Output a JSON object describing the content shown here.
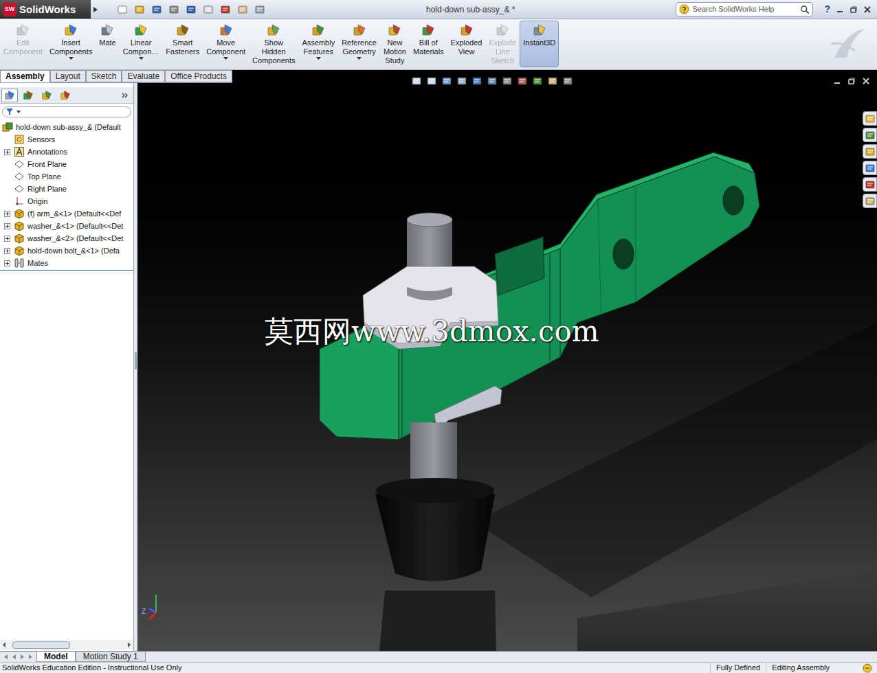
{
  "window": {
    "title": "hold-down sub-assy_& *"
  },
  "logo": {
    "mark": "SW",
    "text": "SolidWorks"
  },
  "search": {
    "placeholder": "Search SolidWorks Help"
  },
  "help": "?",
  "ribbon": [
    {
      "lines": [
        "Edit",
        "Component"
      ],
      "disabled": true,
      "selected": false,
      "dropdown": false
    },
    {
      "lines": [
        "Insert",
        "Components"
      ],
      "disabled": false,
      "selected": false,
      "dropdown": true
    },
    {
      "lines": [
        "Mate"
      ],
      "disabled": false,
      "selected": false,
      "dropdown": false
    },
    {
      "lines": [
        "Linear",
        "Compon…"
      ],
      "disabled": false,
      "selected": false,
      "dropdown": true
    },
    {
      "lines": [
        "Smart",
        "Fasteners"
      ],
      "disabled": false,
      "selected": false,
      "dropdown": false
    },
    {
      "lines": [
        "Move",
        "Component"
      ],
      "disabled": false,
      "selected": false,
      "dropdown": true
    },
    {
      "lines": [
        "Show",
        "Hidden",
        "Components"
      ],
      "disabled": false,
      "selected": false,
      "dropdown": false
    },
    {
      "lines": [
        "Assembly",
        "Features"
      ],
      "disabled": false,
      "selected": false,
      "dropdown": true
    },
    {
      "lines": [
        "Reference",
        "Geometry"
      ],
      "disabled": false,
      "selected": false,
      "dropdown": true
    },
    {
      "lines": [
        "New",
        "Motion",
        "Study"
      ],
      "disabled": false,
      "selected": false,
      "dropdown": false
    },
    {
      "lines": [
        "Bill of",
        "Materials"
      ],
      "disabled": false,
      "selected": false,
      "dropdown": false
    },
    {
      "lines": [
        "Exploded",
        "View"
      ],
      "disabled": false,
      "selected": false,
      "dropdown": false
    },
    {
      "lines": [
        "Explode",
        "Line",
        "Sketch"
      ],
      "disabled": true,
      "selected": false,
      "dropdown": false
    },
    {
      "lines": [
        "Instant3D"
      ],
      "disabled": false,
      "selected": true,
      "dropdown": false
    }
  ],
  "command_tabs": [
    {
      "label": "Assembly",
      "selected": true
    },
    {
      "label": "Layout",
      "selected": false
    },
    {
      "label": "Sketch",
      "selected": false
    },
    {
      "label": "Evaluate",
      "selected": false
    },
    {
      "label": "Office Products",
      "selected": false
    }
  ],
  "panel_tabs": [
    {
      "selected": true
    },
    {
      "selected": false
    },
    {
      "selected": false
    },
    {
      "selected": false
    }
  ],
  "tree": [
    {
      "label": "hold-down sub-assy_& (Default",
      "kind": "assembly",
      "depth": 0,
      "expandable": false,
      "expanded": false
    },
    {
      "label": "Sensors",
      "kind": "sensor",
      "depth": 1,
      "expandable": false,
      "expanded": false
    },
    {
      "label": "Annotations",
      "kind": "annotation",
      "depth": 1,
      "expandable": true,
      "expanded": false
    },
    {
      "label": "Front Plane",
      "kind": "plane",
      "depth": 1,
      "expandable": false,
      "expanded": false
    },
    {
      "label": "Top Plane",
      "kind": "plane",
      "depth": 1,
      "expandable": false,
      "expanded": false
    },
    {
      "label": "Right Plane",
      "kind": "plane",
      "depth": 1,
      "expandable": false,
      "expanded": false
    },
    {
      "label": "Origin",
      "kind": "origin",
      "depth": 1,
      "expandable": false,
      "expanded": false
    },
    {
      "label": "(f) arm_&<1> (Default<<Def",
      "kind": "part",
      "depth": 1,
      "expandable": true,
      "expanded": false
    },
    {
      "label": "washer_&<1> (Default<<Det",
      "kind": "part",
      "depth": 1,
      "expandable": true,
      "expanded": false
    },
    {
      "label": "washer_&<2> (Default<<Det",
      "kind": "part",
      "depth": 1,
      "expandable": true,
      "expanded": false
    },
    {
      "label": "hold-down bolt_&<1> (Defa",
      "kind": "part",
      "depth": 1,
      "expandable": true,
      "expanded": false
    },
    {
      "label": "Mates",
      "kind": "mates",
      "depth": 1,
      "expandable": true,
      "expanded": false
    }
  ],
  "watermark": "莫西网www.3dmox.com",
  "triad": {
    "label": "Z"
  },
  "bottom_tabs": [
    {
      "label": "Model",
      "selected": true
    },
    {
      "label": "Motion Study 1",
      "selected": false
    }
  ],
  "status_bar": {
    "left": "SolidWorks Education Edition - Instructional Use Only",
    "right": [
      "Fully Defined",
      "Editing Assembly"
    ]
  }
}
